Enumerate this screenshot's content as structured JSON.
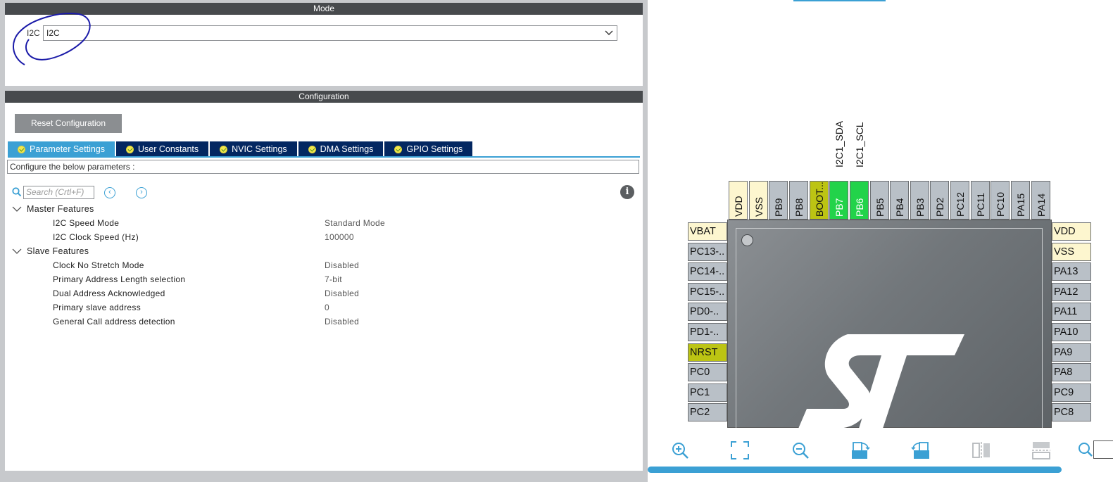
{
  "mode_panel": {
    "header": "Mode",
    "label": "I2C",
    "select_value": "I2C"
  },
  "config_panel": {
    "header": "Configuration",
    "reset_button": "Reset Configuration",
    "tabs": [
      {
        "label": "Parameter Settings",
        "active": true
      },
      {
        "label": "User Constants",
        "active": false
      },
      {
        "label": "NVIC Settings",
        "active": false
      },
      {
        "label": "DMA Settings",
        "active": false
      },
      {
        "label": "GPIO Settings",
        "active": false
      }
    ],
    "description": "Configure the below parameters :",
    "search_placeholder": "Search (Crtl+F)",
    "groups": [
      {
        "name": "Master Features",
        "params": [
          {
            "key": "I2C Speed Mode",
            "value": "Standard Mode"
          },
          {
            "key": "I2C Clock Speed (Hz)",
            "value": "100000"
          }
        ]
      },
      {
        "name": "Slave Features",
        "params": [
          {
            "key": "Clock No Stretch Mode",
            "value": "Disabled"
          },
          {
            "key": "Primary Address Length selection",
            "value": "7-bit"
          },
          {
            "key": "Dual Address Acknowledged",
            "value": "Disabled"
          },
          {
            "key": "Primary slave address",
            "value": "0"
          },
          {
            "key": "General Call address detection",
            "value": "Disabled"
          }
        ]
      }
    ]
  },
  "chip_view": {
    "top_signals": {
      "pb7": "I2C1_SDA",
      "pb6": "I2C1_SCL"
    },
    "top_pins": [
      "VDD",
      "VSS",
      "PB9",
      "PB8",
      "BOOT...",
      "PB7",
      "PB6",
      "PB5",
      "PB4",
      "PB3",
      "PD2",
      "PC12",
      "PC11",
      "PC10",
      "PA15",
      "PA14"
    ],
    "left_pins": [
      "VBAT",
      "PC13-..",
      "PC14-..",
      "PC15-..",
      "PD0-..",
      "PD1-..",
      "NRST",
      "PC0",
      "PC1",
      "PC2"
    ],
    "right_pins": [
      "VDD",
      "VSS",
      "PA13",
      "PA12",
      "PA11",
      "PA10",
      "PA9",
      "PA8",
      "PC9",
      "PC8"
    ],
    "colors": {
      "power": "#fdf6cf",
      "boot_reset": "#bcc413",
      "active": "#22d34a",
      "default": "#b9c0c7",
      "accent": "#3ba0d4",
      "tab_dark": "#032761"
    },
    "toolbar_icons": [
      "zoom-in-icon",
      "fit-screen-icon",
      "zoom-out-icon",
      "rotate-right-icon",
      "rotate-left-icon",
      "flip-vertical-icon",
      "flip-horizontal-icon",
      "search-icon"
    ]
  }
}
